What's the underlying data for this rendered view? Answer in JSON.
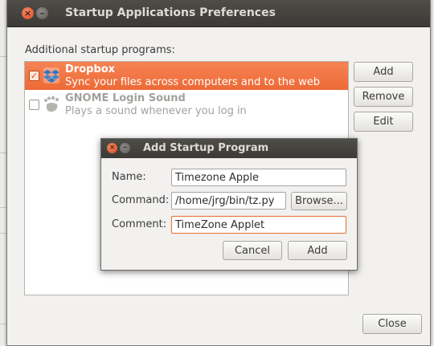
{
  "window": {
    "title": "Startup Applications Preferences"
  },
  "section_label": "Additional startup programs:",
  "programs": [
    {
      "name": "Dropbox",
      "description": "Sync your files across computers and to the web",
      "enabled": true,
      "selected": true,
      "icon": "dropbox-icon"
    },
    {
      "name": "GNOME Login Sound",
      "description": "Plays a sound whenever you log in",
      "enabled": false,
      "selected": false,
      "icon": "gnome-foot-icon"
    }
  ],
  "buttons": {
    "add": "Add",
    "remove": "Remove",
    "edit": "Edit",
    "close": "Close"
  },
  "dialog": {
    "title": "Add Startup Program",
    "name_label": "Name:",
    "name_value": "Timezone Apple",
    "command_label": "Command:",
    "command_value": "/home/jrg/bin/tz.py",
    "browse_label": "Browse...",
    "comment_label": "Comment:",
    "comment_value": "TimeZone Applet",
    "cancel_label": "Cancel",
    "add_label": "Add"
  },
  "colors": {
    "selection": "#f07746",
    "titlebar": "#45443f",
    "close_button": "#e05a2b"
  }
}
